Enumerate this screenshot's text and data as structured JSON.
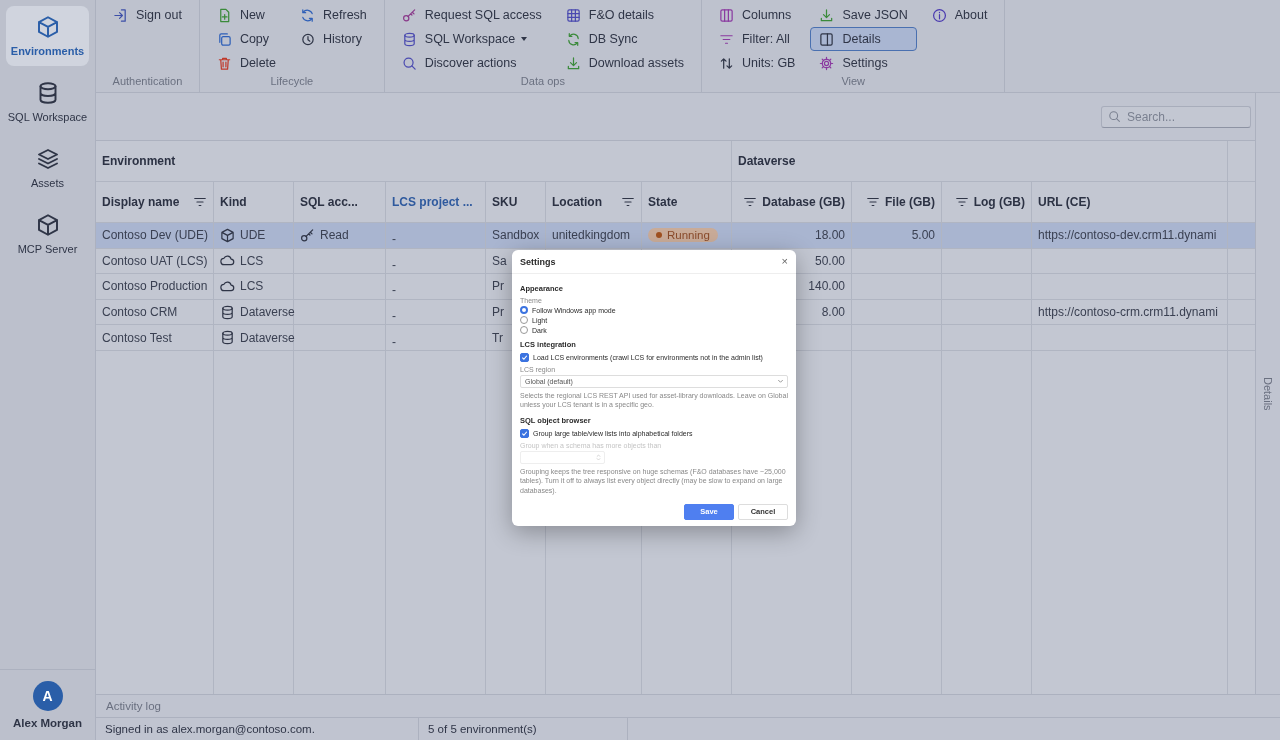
{
  "sidebar": {
    "items": [
      {
        "label": "Environments",
        "selected": true
      },
      {
        "label": "SQL Workspace",
        "selected": false
      },
      {
        "label": "Assets",
        "selected": false
      },
      {
        "label": "MCP Server",
        "selected": false
      }
    ],
    "user": {
      "initial": "A",
      "name": "Alex Morgan"
    }
  },
  "toolbar": {
    "groups": [
      {
        "label": "Authentication",
        "columns": [
          [
            {
              "label": "Sign out",
              "selected": false
            }
          ]
        ]
      },
      {
        "label": "Lifecycle",
        "columns": [
          [
            {
              "label": "New",
              "selected": false
            },
            {
              "label": "Copy",
              "selected": false
            },
            {
              "label": "Delete",
              "selected": false
            }
          ],
          [
            {
              "label": "Refresh",
              "selected": false
            },
            {
              "label": "History",
              "selected": false
            }
          ]
        ]
      },
      {
        "label": "Data ops",
        "columns": [
          [
            {
              "label": "Request SQL access",
              "selected": false
            },
            {
              "label": "SQL Workspace",
              "selected": false,
              "dropdown": true
            },
            {
              "label": "Discover actions",
              "selected": false
            }
          ],
          [
            {
              "label": "F&O details",
              "selected": false
            },
            {
              "label": "DB Sync",
              "selected": false
            },
            {
              "label": "Download assets",
              "selected": false
            }
          ]
        ]
      },
      {
        "label": "View",
        "columns": [
          [
            {
              "label": "Columns",
              "selected": false
            },
            {
              "label": "Filter: All",
              "selected": false
            },
            {
              "label": "Units: GB",
              "selected": false
            }
          ],
          [
            {
              "label": "Save JSON",
              "selected": false
            },
            {
              "label": "Details",
              "selected": true
            },
            {
              "label": "Settings",
              "selected": false
            }
          ],
          [
            {
              "label": "About",
              "selected": false
            }
          ]
        ]
      }
    ]
  },
  "search": {
    "placeholder": "Search..."
  },
  "table": {
    "groups": [
      {
        "label": "Environment",
        "columns": [
          {
            "label": "Display name",
            "filter": true,
            "kind": "text",
            "highlighted": false
          },
          {
            "label": "Kind",
            "filter": false,
            "kind": "text",
            "highlighted": false
          },
          {
            "label": "SQL acc...",
            "filter": false,
            "kind": "text",
            "highlighted": false
          },
          {
            "label": "LCS project ...",
            "filter": false,
            "kind": "text",
            "highlighted": true
          },
          {
            "label": "SKU",
            "filter": false,
            "kind": "text",
            "highlighted": false
          },
          {
            "label": "Location",
            "filter": true,
            "kind": "text",
            "highlighted": false
          },
          {
            "label": "State",
            "filter": false,
            "kind": "text",
            "highlighted": false
          }
        ]
      },
      {
        "label": "Dataverse",
        "columns": [
          {
            "label": "Database (GB)",
            "filter": true,
            "kind": "number",
            "highlighted": false
          },
          {
            "label": "File (GB)",
            "filter": true,
            "kind": "number",
            "highlighted": false
          },
          {
            "label": "Log (GB)",
            "filter": true,
            "kind": "number",
            "highlighted": false
          },
          {
            "label": "URL (CE)",
            "filter": false,
            "kind": "text",
            "highlighted": false
          }
        ]
      }
    ],
    "rows": [
      {
        "selected": true,
        "cells": [
          {
            "text": "Contoso Dev (UDE)"
          },
          {
            "text": "UDE",
            "kind": "ude"
          },
          {
            "text": "Read",
            "kind": "key"
          },
          {
            "text": "-"
          },
          {
            "text": "Sandbox"
          },
          {
            "text": "unitedkingdom"
          },
          {
            "text": "Running",
            "kind": "badge"
          },
          {
            "text": "18.00"
          },
          {
            "text": "5.00"
          },
          {},
          {
            "text": "https://contoso-dev.crm11.dynami"
          }
        ]
      },
      {
        "selected": false,
        "cells": [
          {
            "text": "Contoso UAT (LCS)"
          },
          {
            "text": "LCS",
            "kind": "lcs"
          },
          {},
          {
            "text": "-"
          },
          {
            "text": "Sa"
          },
          {},
          {},
          {
            "text": "50.00"
          },
          {},
          {},
          {}
        ]
      },
      {
        "selected": false,
        "cells": [
          {
            "text": "Contoso Production"
          },
          {
            "text": "LCS",
            "kind": "lcs"
          },
          {},
          {
            "text": "-"
          },
          {
            "text": "Pr"
          },
          {},
          {},
          {
            "text": "140.00"
          },
          {},
          {},
          {}
        ]
      },
      {
        "selected": false,
        "cells": [
          {
            "text": "Contoso CRM"
          },
          {
            "text": "Dataverse",
            "kind": "dataverse"
          },
          {},
          {
            "text": "-"
          },
          {
            "text": "Pr"
          },
          {},
          {},
          {
            "text": "8.00"
          },
          {},
          {},
          {
            "text": "https://contoso-crm.crm11.dynami"
          }
        ]
      },
      {
        "selected": false,
        "cells": [
          {
            "text": "Contoso Test"
          },
          {
            "text": "Dataverse",
            "kind": "dataverse"
          },
          {},
          {
            "text": "-"
          },
          {
            "text": "Tr"
          },
          {},
          {},
          {},
          {},
          {},
          {}
        ]
      }
    ]
  },
  "details_pane": {
    "label": "Details"
  },
  "activity_log": {
    "label": "Activity log"
  },
  "status_bar": [
    "Signed in as alex.morgan@contoso.com.",
    "5 of 5 environment(s)"
  ],
  "dialog": {
    "title": "Settings",
    "close": "×",
    "sections": [
      {
        "heading": "Appearance",
        "items": [
          {
            "kind": "label",
            "text": "Theme",
            "disabled": false
          },
          {
            "kind": "radio",
            "label": "Follow Windows app mode",
            "selected": true
          },
          {
            "kind": "radio",
            "label": "Light",
            "selected": false
          },
          {
            "kind": "radio",
            "label": "Dark",
            "selected": false
          }
        ]
      },
      {
        "heading": "LCS integration",
        "items": [
          {
            "kind": "checkbox",
            "label": "Load LCS environments (crawl LCS for environments not in the admin list)",
            "checked": true
          },
          {
            "kind": "label",
            "text": "LCS region",
            "disabled": false
          },
          {
            "kind": "select",
            "value": "Global (default)"
          },
          {
            "kind": "help",
            "text": "Selects the regional LCS REST API used for asset-library downloads. Leave on Global unless your LCS tenant is in a specific geo."
          }
        ]
      },
      {
        "heading": "SQL object browser",
        "items": [
          {
            "kind": "checkbox",
            "label": "Group large table/view lists into alphabetical folders",
            "checked": true
          },
          {
            "kind": "label",
            "text": "Group when a schema has more objects than",
            "disabled": true
          },
          {
            "kind": "number",
            "disabled": true
          },
          {
            "kind": "help",
            "text": "Grouping keeps the tree responsive on huge schemas (F&O databases have ~25,000 tables). Turn it off to always list every object directly (may be slow to expand on large databases)."
          }
        ]
      }
    ],
    "buttons": [
      {
        "label": "Save",
        "primary": true
      },
      {
        "label": "Cancel",
        "primary": false
      }
    ]
  }
}
